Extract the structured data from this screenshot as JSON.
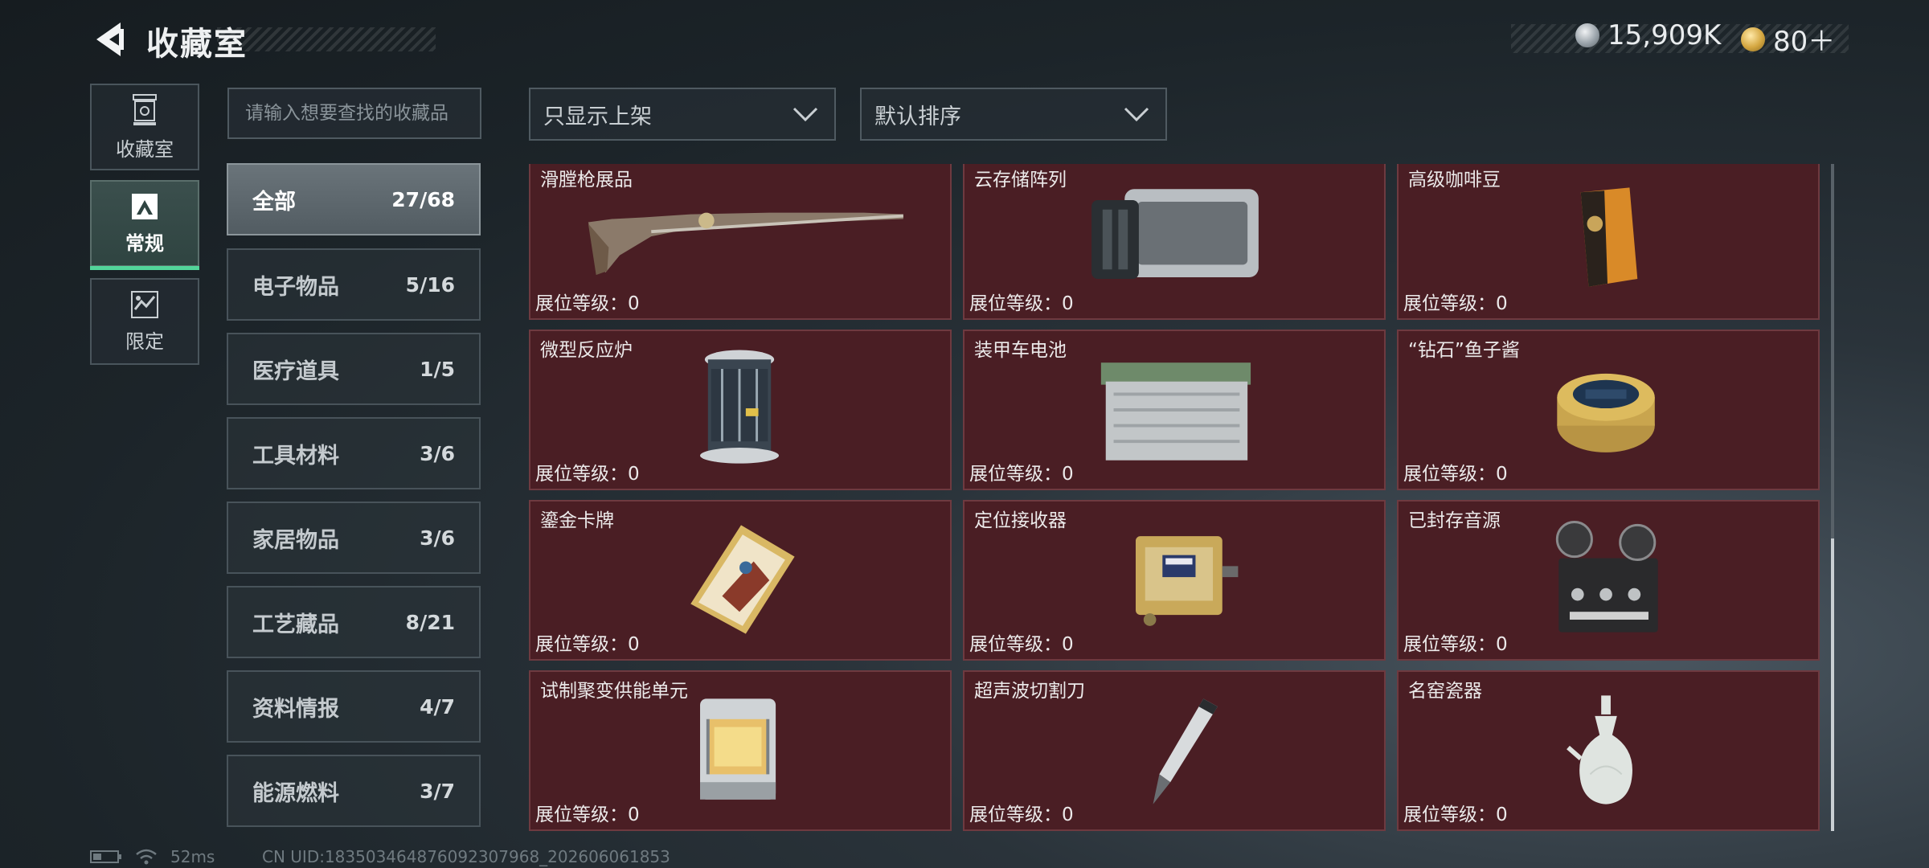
{
  "header": {
    "title": "收藏室"
  },
  "currencies": [
    {
      "icon": "silver-coin-icon",
      "value": "15,909K"
    },
    {
      "icon": "gold-coin-icon",
      "value": "80＋"
    }
  ],
  "side_tabs": [
    {
      "label": "收藏室",
      "icon": "display-case-icon"
    },
    {
      "label": "常规",
      "icon": "regular-collection-icon",
      "active": true
    },
    {
      "label": "限定",
      "icon": "limited-collection-icon"
    }
  ],
  "search": {
    "placeholder": "请输入想要查找的收藏品"
  },
  "filters": {
    "display_filter": "只显示上架",
    "sort": "默认排序"
  },
  "categories": [
    {
      "name": "全部",
      "count": "27/68",
      "active": true
    },
    {
      "name": "电子物品",
      "count": "5/16"
    },
    {
      "name": "医疗道具",
      "count": "1/5"
    },
    {
      "name": "工具材料",
      "count": "3/6"
    },
    {
      "name": "家居物品",
      "count": "3/6"
    },
    {
      "name": "工艺藏品",
      "count": "8/21"
    },
    {
      "name": "资料情报",
      "count": "4/7"
    },
    {
      "name": "能源燃料",
      "count": "3/7"
    }
  ],
  "items": [
    {
      "name": "滑膛枪展品",
      "level": "展位等级：0",
      "icon": "musket-icon"
    },
    {
      "name": "云存储阵列",
      "level": "展位等级：0",
      "icon": "cloud-storage-array-icon"
    },
    {
      "name": "高级咖啡豆",
      "level": "展位等级：0",
      "icon": "coffee-bag-icon"
    },
    {
      "name": "微型反应炉",
      "level": "展位等级：0",
      "icon": "micro-reactor-icon"
    },
    {
      "name": "装甲车电池",
      "level": "展位等级：0",
      "icon": "vehicle-battery-icon"
    },
    {
      "name": "“钻石”鱼子酱",
      "level": "展位等级：0",
      "icon": "caviar-tin-icon"
    },
    {
      "name": "鎏金卡牌",
      "level": "展位等级：0",
      "icon": "gilded-card-icon"
    },
    {
      "name": "定位接收器",
      "level": "展位等级：0",
      "icon": "gps-receiver-icon"
    },
    {
      "name": "已封存音源",
      "level": "展位等级：0",
      "icon": "reel-recorder-icon"
    },
    {
      "name": "试制聚变供能单元",
      "level": "展位等级：0",
      "icon": "fusion-cell-icon"
    },
    {
      "name": "超声波切割刀",
      "level": "展位等级：0",
      "icon": "ultrasonic-cutter-icon"
    },
    {
      "name": "名窑瓷器",
      "level": "展位等级：0",
      "icon": "porcelain-vase-icon"
    }
  ],
  "status": {
    "latency": "52ms",
    "uid": "CN UID:18350346487609230​7968_202606061853"
  }
}
